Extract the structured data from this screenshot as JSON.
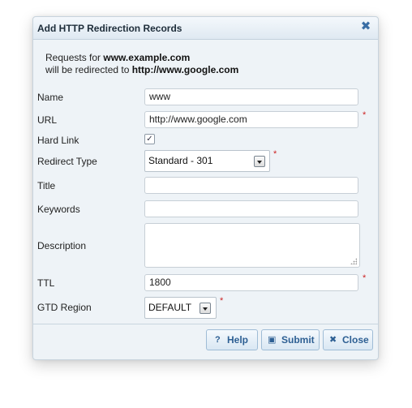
{
  "dialog": {
    "title": "Add HTTP Redirection Records",
    "close_symbol": "✖"
  },
  "info": {
    "line1_prefix": "Requests for ",
    "line1_domain": "www.example.com",
    "line2_prefix": "will be redirected to ",
    "line2_url": "http://www.google.com"
  },
  "form": {
    "name_label": "Name",
    "name_value": "www",
    "url_label": "URL",
    "url_value": "http://www.google.com",
    "hardlink_label": "Hard Link",
    "hardlink_checked": "✓",
    "redirect_label": "Redirect Type",
    "redirect_value": "Standard - 301",
    "title_label": "Title",
    "title_value": "",
    "keywords_label": "Keywords",
    "keywords_value": "",
    "description_label": "Description",
    "ttl_label": "TTL",
    "ttl_value": "1800",
    "gtd_label": "GTD Region",
    "gtd_value": "DEFAULT",
    "required_mark": "*"
  },
  "buttons": {
    "help_icon": "?",
    "help_label": "Help",
    "submit_icon": "▣",
    "submit_label": "Submit",
    "close_icon": "✖",
    "close_label": "Close"
  },
  "colors": {
    "accent": "#2d5f93",
    "required": "#cc2222",
    "dialog_bg": "#eef3f7"
  }
}
